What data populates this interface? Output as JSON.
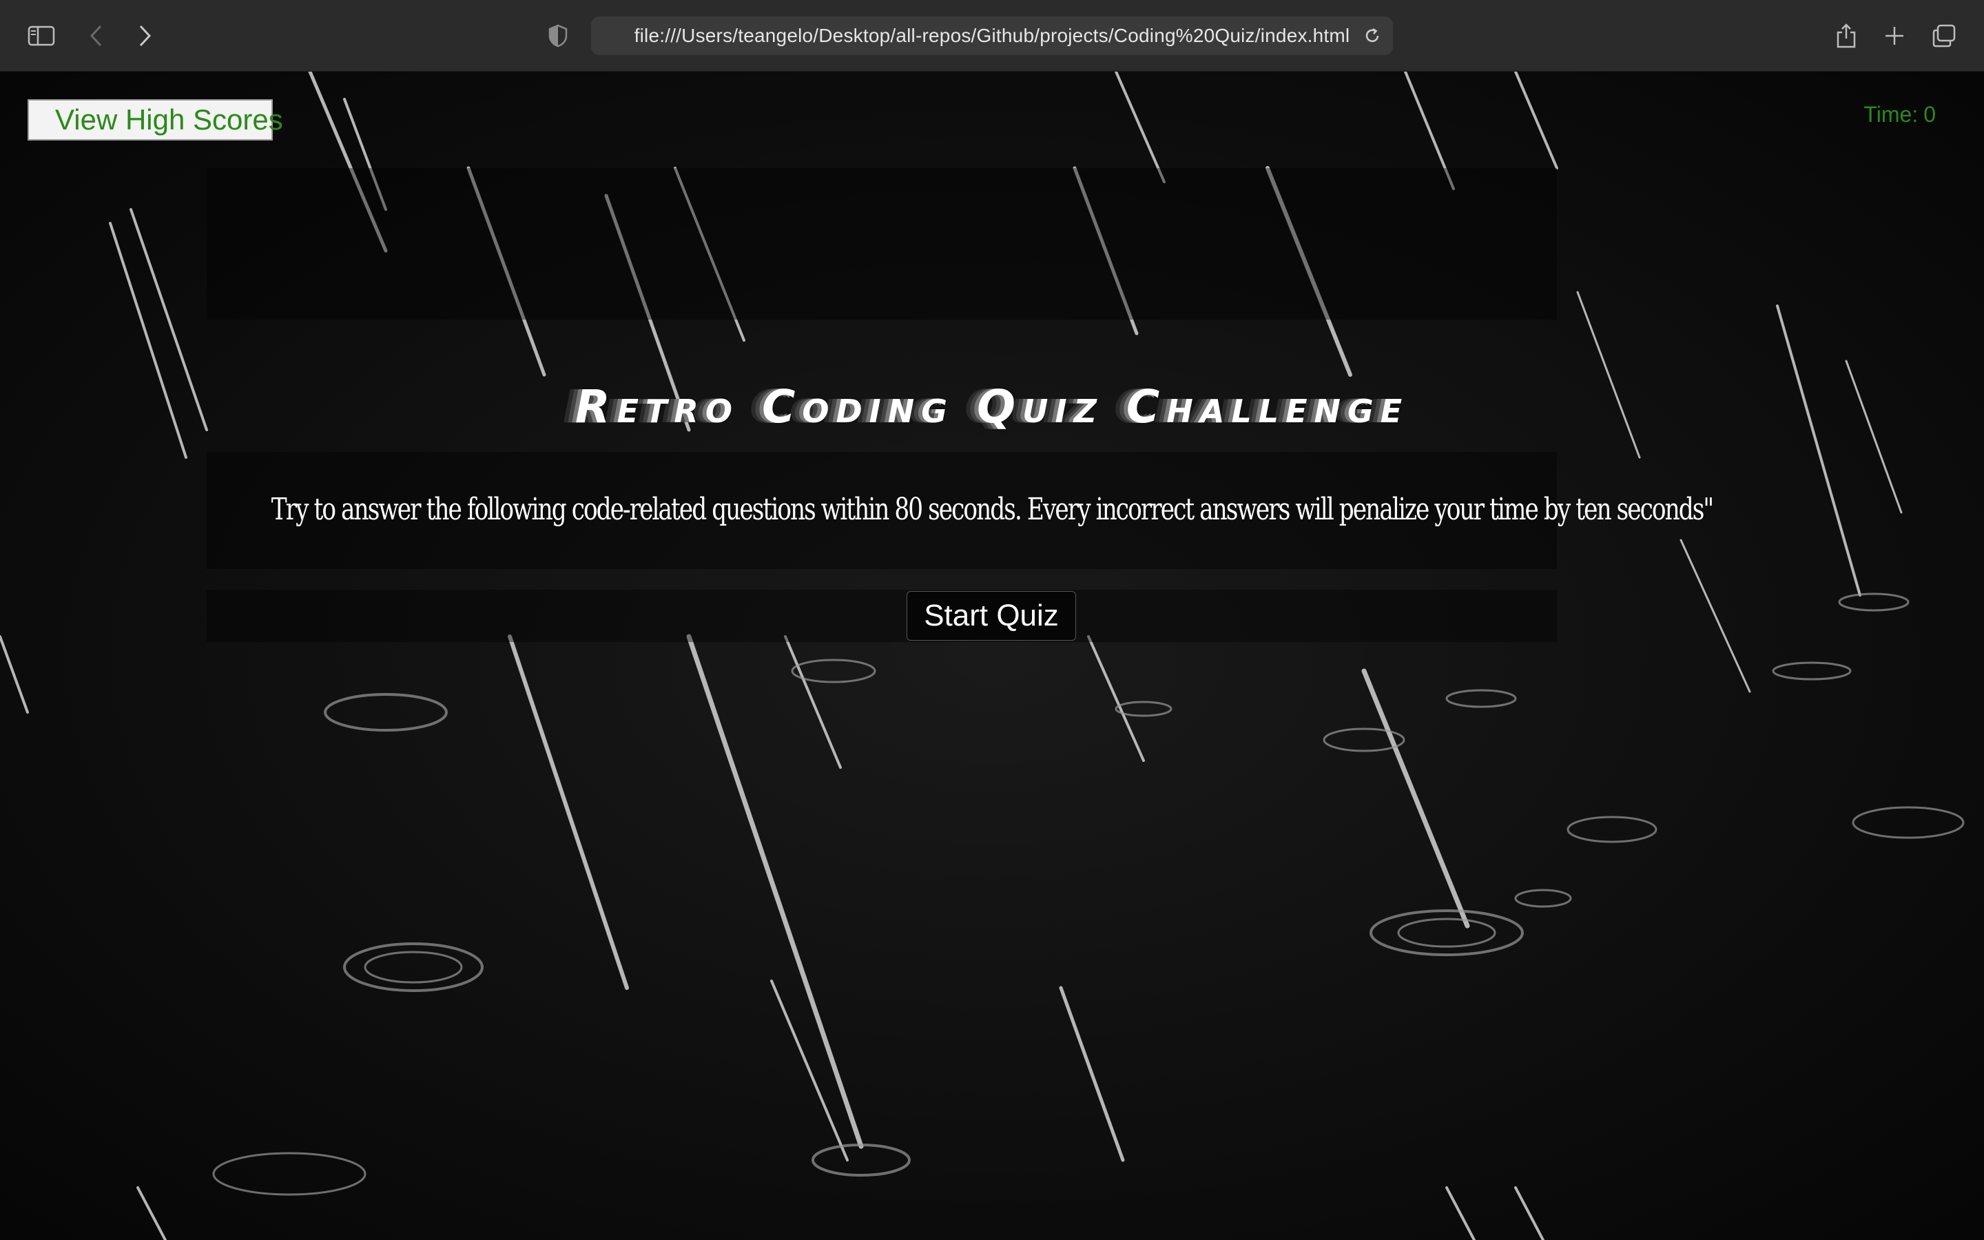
{
  "browser": {
    "url": "file:///Users/teangelo/Desktop/all-repos/Github/projects/Coding%20Quiz/index.html",
    "icons": {
      "sidebar": "sidebar-icon",
      "back": "chevron-left-icon",
      "forward": "chevron-right-icon",
      "privacy": "shield-icon",
      "reload": "reload-icon",
      "share": "share-icon",
      "new_tab": "plus-icon",
      "tabs": "tab-overview-icon"
    }
  },
  "page": {
    "high_scores_label": "View High Scores",
    "timer_label": "Time:",
    "timer_value": "0",
    "title": "Retro Coding Quiz Challenge",
    "intro": "Try to answer the following code-related questions within 80 seconds. Every incorrect answers will penalize your time by ten seconds\"",
    "start_label": "Start Quiz"
  },
  "colors": {
    "accent_green": "#2a8a1a",
    "background": "#0d0d0d",
    "text": "#ffffff"
  }
}
